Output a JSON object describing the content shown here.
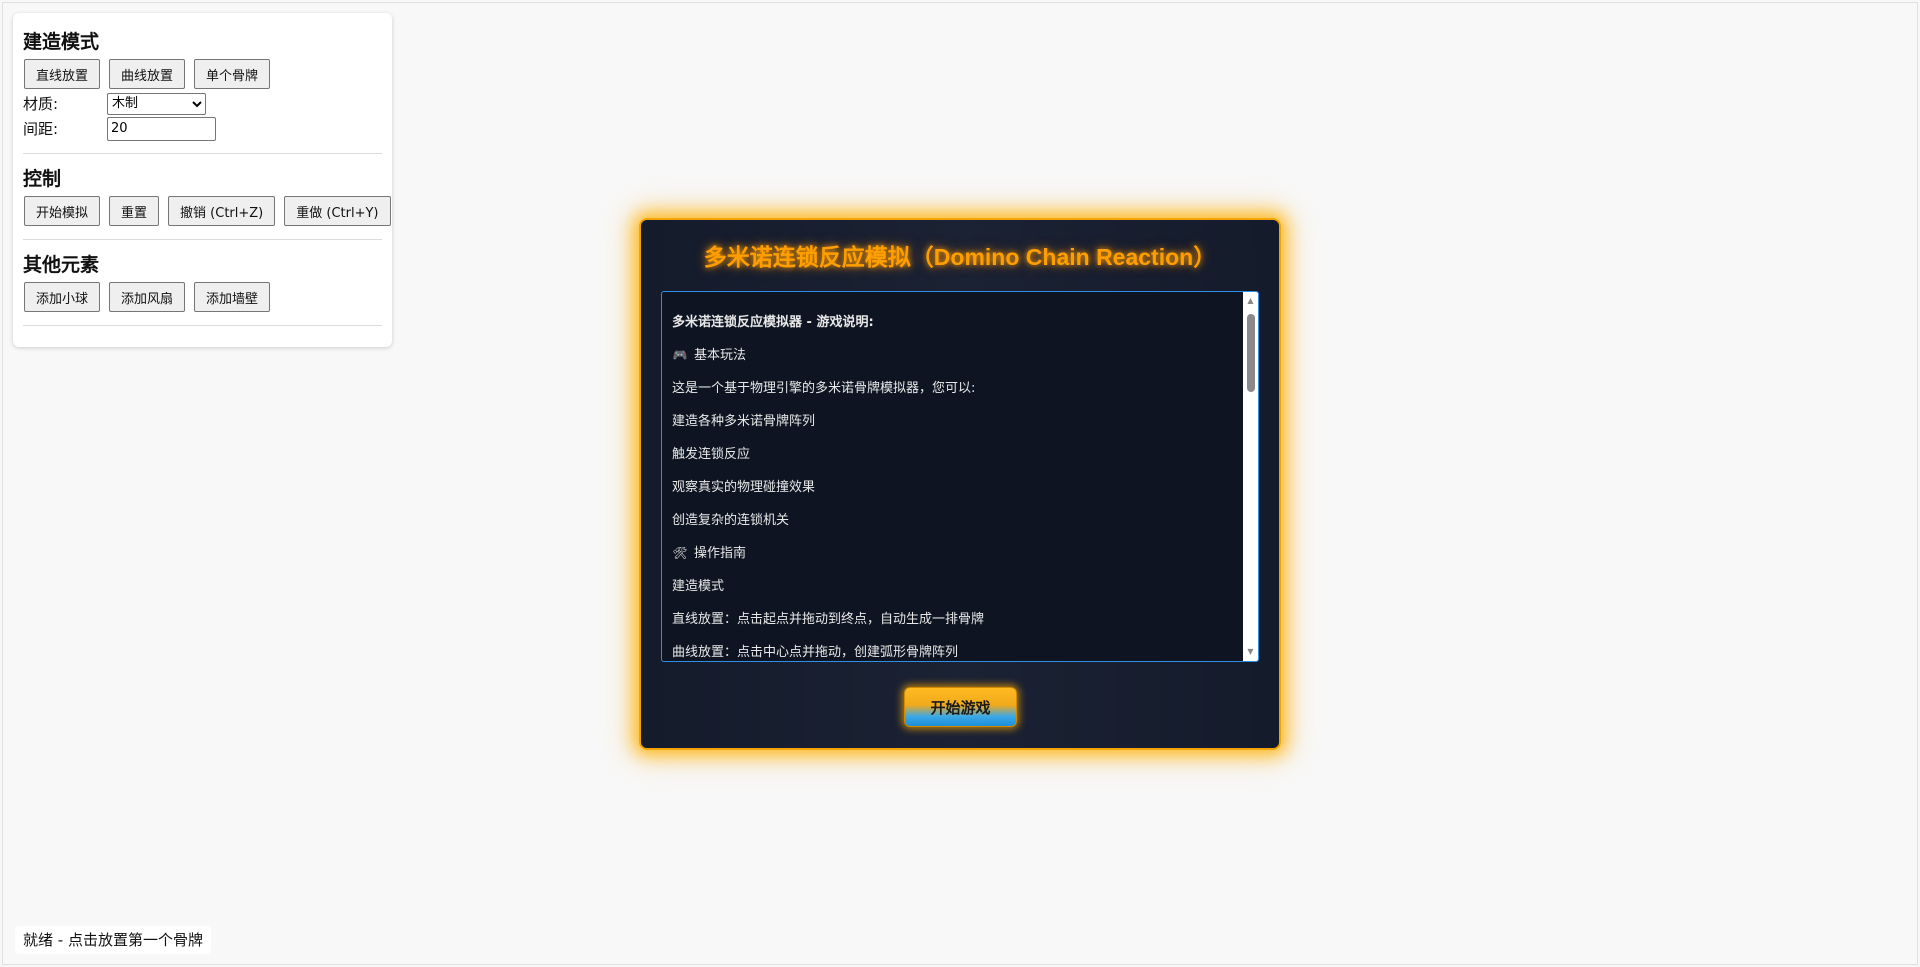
{
  "panel": {
    "build": {
      "title": "建造模式",
      "buttons": [
        "直线放置",
        "曲线放置",
        "单个骨牌"
      ],
      "material_label": "材质:",
      "material_value": "木制",
      "spacing_label": "间距:",
      "spacing_value": "20"
    },
    "control": {
      "title": "控制",
      "buttons": [
        "开始模拟",
        "重置",
        "撤销 (Ctrl+Z)",
        "重做 (Ctrl+Y)"
      ]
    },
    "other": {
      "title": "其他元素",
      "buttons": [
        "添加小球",
        "添加风扇",
        "添加墙壁"
      ]
    }
  },
  "status": "就绪 - 点击放置第一个骨牌",
  "modal": {
    "title": "多米诺连锁反应模拟（Domino Chain Reaction）",
    "lines": [
      {
        "text": "多米诺连锁反应模拟器 - 游戏说明:",
        "bold": true,
        "icon": ""
      },
      {
        "text": "基本玩法",
        "bold": false,
        "icon": "🎮"
      },
      {
        "text": "这是一个基于物理引擎的多米诺骨牌模拟器，您可以:",
        "bold": false,
        "icon": ""
      },
      {
        "text": "建造各种多米诺骨牌阵列",
        "bold": false,
        "icon": ""
      },
      {
        "text": "触发连锁反应",
        "bold": false,
        "icon": ""
      },
      {
        "text": "观察真实的物理碰撞效果",
        "bold": false,
        "icon": ""
      },
      {
        "text": "创造复杂的连锁机关",
        "bold": false,
        "icon": ""
      },
      {
        "text": "操作指南",
        "bold": false,
        "icon": "🛠"
      },
      {
        "text": "建造模式",
        "bold": false,
        "icon": ""
      },
      {
        "text": "直线放置：点击起点并拖动到终点，自动生成一排骨牌",
        "bold": false,
        "icon": ""
      },
      {
        "text": "曲线放置：点击中心点并拖动，创建弧形骨牌阵列",
        "bold": false,
        "icon": ""
      }
    ],
    "start_button": "开始游戏"
  },
  "colors": {
    "modal_border": "#f5a300",
    "title": "#ff9e00",
    "instructions_border": "#2f8fe6"
  }
}
